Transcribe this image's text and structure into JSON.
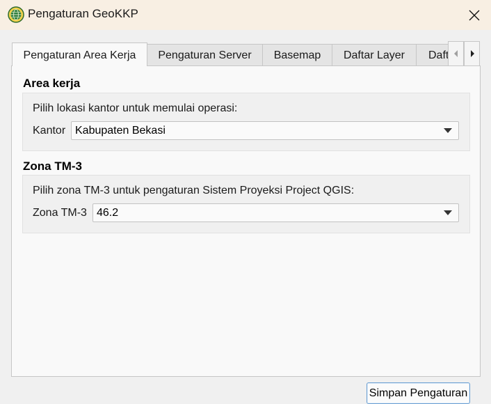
{
  "window": {
    "title": "Pengaturan GeoKKP"
  },
  "tabs": [
    {
      "label": "Pengaturan Area Kerja",
      "active": true
    },
    {
      "label": "Pengaturan Server"
    },
    {
      "label": "Basemap"
    },
    {
      "label": "Daftar Layer"
    },
    {
      "label": "Daftar"
    }
  ],
  "area_kerja": {
    "title": "Area kerja",
    "instruction": "Pilih lokasi kantor untuk memulai operasi:",
    "kantor_label": "Kantor",
    "kantor_value": "Kabupaten Bekasi"
  },
  "zona": {
    "title": "Zona TM-3",
    "instruction": "Pilih zona TM-3 untuk pengaturan Sistem Proyeksi Project QGIS:",
    "zona_label": "Zona TM-3",
    "zona_value": "46.2"
  },
  "buttons": {
    "save": "Simpan Pengaturan"
  },
  "icons": {
    "app": "geokkp-globe-icon",
    "close": "close-icon",
    "scroll_left": "chevron-left-icon",
    "scroll_right": "chevron-right-icon",
    "dropdown": "dropdown-arrow-icon"
  }
}
